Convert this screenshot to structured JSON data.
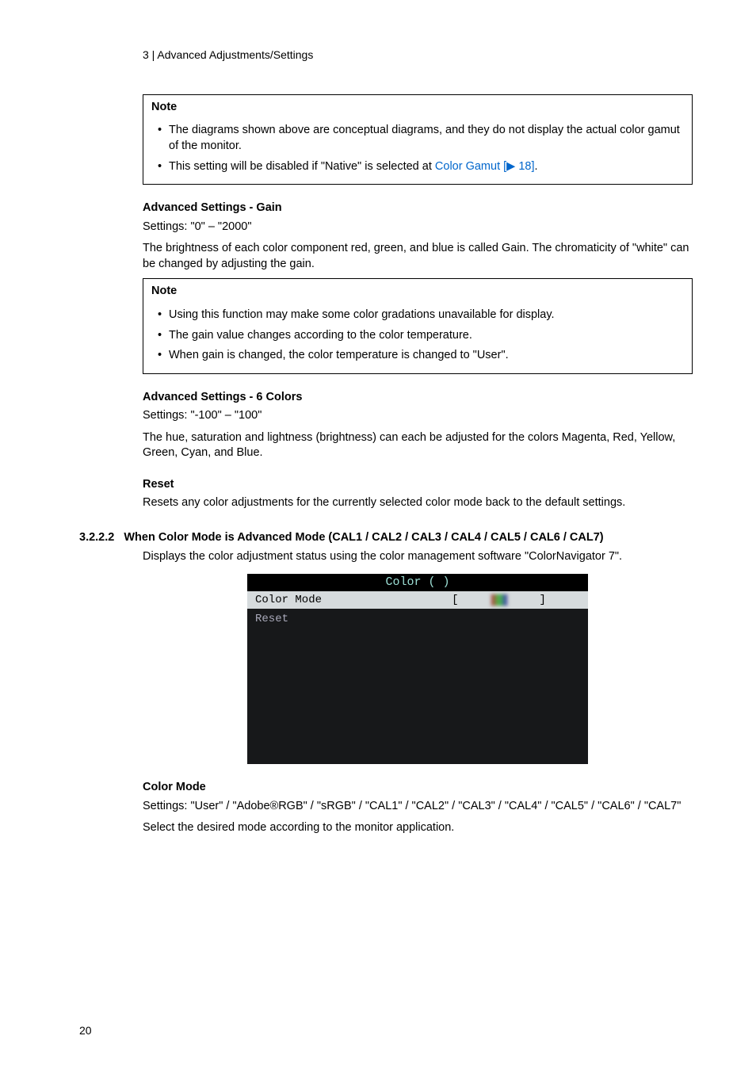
{
  "runningHeader": "3 | Advanced Adjustments/Settings",
  "note1": {
    "title": "Note",
    "items_0": "The diagrams shown above are conceptual diagrams, and they do not display the actual color gamut of the monitor.",
    "items_1_pre": "This setting will be disabled if \"Native\" is selected at ",
    "items_1_link": "Color Gamut [▶ 18]",
    "items_1_post": "."
  },
  "gain": {
    "heading": "Advanced Settings - Gain",
    "settings": "Settings: \"0\" – \"2000\"",
    "desc": "The brightness of each color component red, green, and blue is called Gain. The chromaticity of \"white\" can be changed by adjusting the gain."
  },
  "note2": {
    "title": "Note",
    "items_0": "Using this function may make some color gradations unavailable for display.",
    "items_1": "The gain value changes according to the color temperature.",
    "items_2": "When gain is changed, the color temperature is changed to \"User\"."
  },
  "sixColors": {
    "heading": "Advanced Settings - 6 Colors",
    "settings": "Settings: \"-100\" – \"100\"",
    "desc": "The hue, saturation and lightness (brightness) can each be adjusted for the colors Magenta, Red, Yellow, Green, Cyan, and Blue."
  },
  "reset": {
    "heading": "Reset",
    "desc": "Resets any color adjustments for the currently selected color mode back to the default settings."
  },
  "advMode": {
    "num": "3.2.2.2",
    "heading": "When Color Mode is Advanced Mode (CAL1 / CAL2 / CAL3 / CAL4 / CAL5 / CAL6 / CAL7)",
    "desc": "Displays the color adjustment status using the color management software \"ColorNavigator 7\"."
  },
  "osd": {
    "title": "Color (    )",
    "row_sel_label": "Color Mode",
    "row_sel_lb": "[",
    "row_sel_rb": "]",
    "row_reset": "Reset"
  },
  "colorMode": {
    "heading": "Color Mode",
    "settings": "Settings: \"User\" / \"Adobe®RGB\" / \"sRGB\" / \"CAL1\" / \"CAL2\" / \"CAL3\" / \"CAL4\" / \"CAL5\" / \"CAL6\" / \"CAL7\"",
    "desc": "Select the desired mode according to the monitor application."
  },
  "pageNumber": "20"
}
